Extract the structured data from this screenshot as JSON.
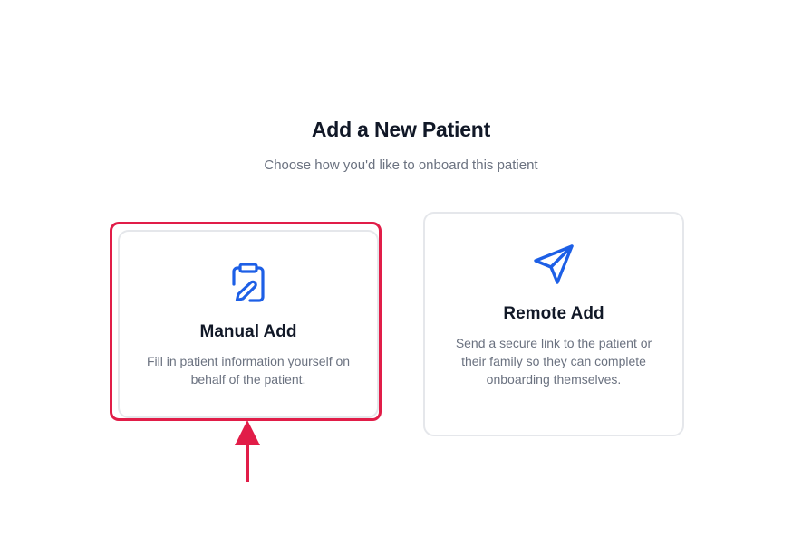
{
  "header": {
    "title": "Add a New Patient",
    "subtitle": "Choose how you'd like to onboard this patient"
  },
  "options": {
    "manual": {
      "title": "Manual Add",
      "description": "Fill in patient information yourself on behalf of the patient.",
      "icon": "clipboard-pen-icon"
    },
    "remote": {
      "title": "Remote Add",
      "description": "Send a secure link to the patient or their family so they can complete onboarding themselves.",
      "icon": "send-icon"
    }
  },
  "colors": {
    "accent": "#1d5fe6",
    "highlight": "#e11d48",
    "title": "#111827",
    "muted": "#6b7280",
    "border": "#e5e7eb"
  }
}
